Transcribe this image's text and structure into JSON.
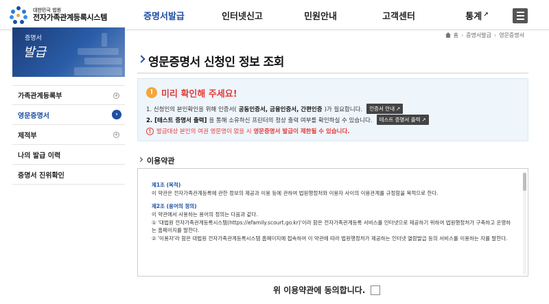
{
  "header": {
    "logo_small": "대한민국 법원",
    "logo_big": "전자가족관계등록시스템",
    "nav": [
      {
        "label": "증명서발급",
        "active": true,
        "external": false
      },
      {
        "label": "인터넷신고",
        "active": false,
        "external": false
      },
      {
        "label": "민원안내",
        "active": false,
        "external": false
      },
      {
        "label": "고객센터",
        "active": false,
        "external": false
      },
      {
        "label": "통계",
        "active": false,
        "external": true
      }
    ],
    "menu_icon": "hamburger-icon"
  },
  "sidebar": {
    "banner_line1": "증명서",
    "banner_line2": "발급",
    "items": [
      {
        "label": "가족관계등록부",
        "state": "expandable"
      },
      {
        "label": "영문증명서",
        "state": "active"
      },
      {
        "label": "제적부",
        "state": "expandable"
      },
      {
        "label": "나의 발급 이력",
        "state": "none"
      },
      {
        "label": "증명서 진위확인",
        "state": "none"
      }
    ]
  },
  "breadcrumb": {
    "home": "홈",
    "level1": "증명서발급",
    "level2": "영문증명서"
  },
  "page": {
    "title": "영문증명서 신청인 정보 조회"
  },
  "notice": {
    "heading": "미리 확인해 주세요!",
    "line1_prefix": "1. 신청인의 본인확인을 위해 인증서(",
    "line1_bold": "공동인증서, 금융인증서, 간편인증",
    "line1_suffix": ")가 필요합니다.",
    "line1_button": "인증서 안내",
    "line2_bold": "2. [테스트 증명서 출력]",
    "line2_suffix": "을 통해 소유하신 프린터의 정상 출력 여부를 확인하실 수 있습니다.",
    "line2_button": "테스트 증명서 출력",
    "warning_prefix": "발급대상 본인의 여권 영문명이 없을 시 ",
    "warning_bold": "영문증명서 발급이 제한될 수 있습니다."
  },
  "terms": {
    "title": "이용약관",
    "article1_title": "제1조 (목적)",
    "article1_body": "이 약관은 전자가족관계등록에 관한 정보의 제공과 이용 등에 관하여 법원행정처와 이용자 사이의 이용관계를 규정함을 목적으로 한다.",
    "article2_title": "제2조 (용어의 정의)",
    "article2_intro": "이 약관에서 사용하는 용어의 정의는 다음과 같다.",
    "article2_item1": "① '대법원 전자가족관계등록시스템(https://efamily.scourt.go.kr)'이라 함은 전자가족관계등록 서비스를 인터넷으로 제공하기 위하여 법원행정처가 구축하고 운영하는 홈페이지를 말한다.",
    "article2_item2": "② '이용자'라 함은 대법원 전자가족관계등록시스템 홈페이지에 접속하여 이 약관에 따라 법원행정처가 제공하는 인터넷 열람발급 등의 서비스를 이용하는 자를 말한다."
  },
  "agree": {
    "label": "위 이용약관에 동의합니다.",
    "checked": false
  }
}
